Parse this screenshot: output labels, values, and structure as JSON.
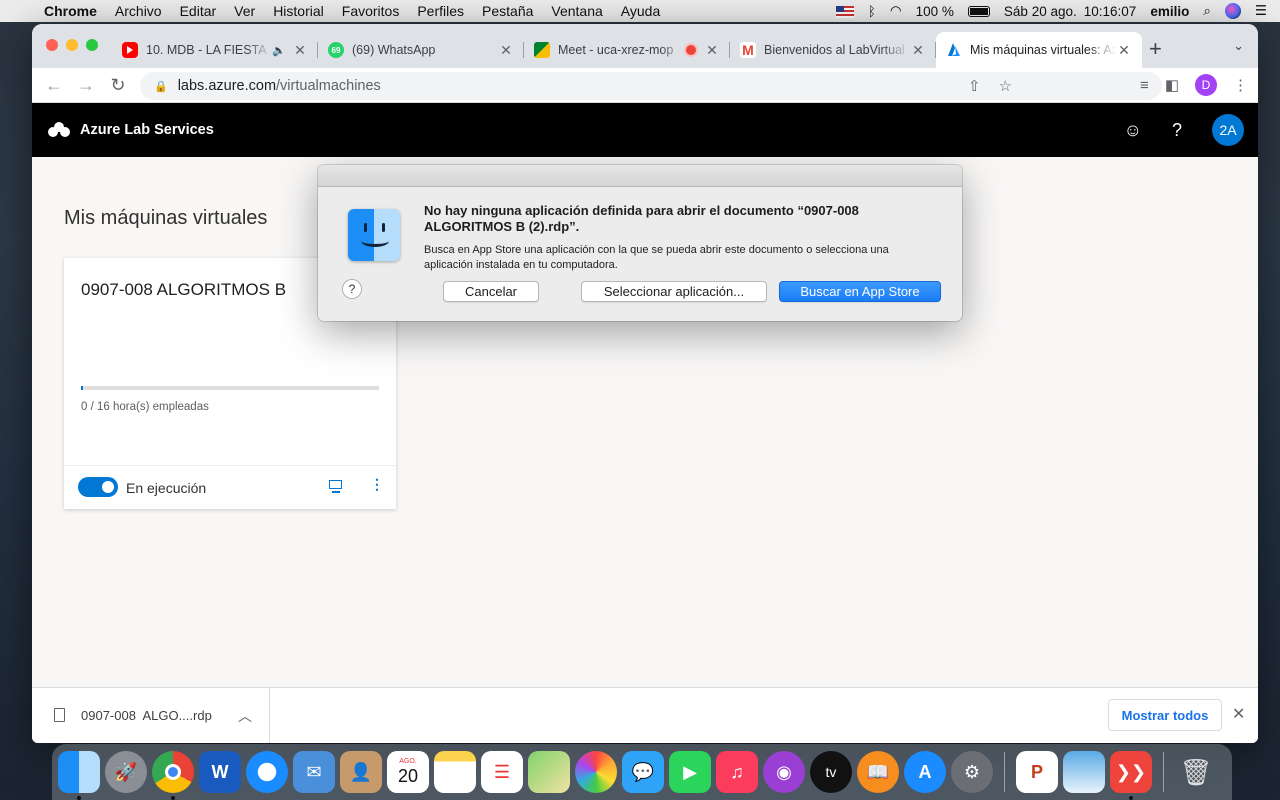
{
  "menubar": {
    "app": "Chrome",
    "items": [
      "Archivo",
      "Editar",
      "Ver",
      "Historial",
      "Favoritos",
      "Perfiles",
      "Pestaña",
      "Ventana",
      "Ayuda"
    ],
    "battery": "100 %",
    "date": "Sáb 20 ago.",
    "time": "10:16:07",
    "user": "emilio"
  },
  "tabs": [
    {
      "title": "10. MDB - LA FIESTA",
      "icon": "youtube-icon"
    },
    {
      "title": "(69) WhatsApp",
      "icon": "whatsapp-icon",
      "badge": "69"
    },
    {
      "title": "Meet - uca-xrez-mop",
      "icon": "meet-icon"
    },
    {
      "title": "Bienvenidos al LabVirtual",
      "icon": "gmail-icon"
    },
    {
      "title": "Mis máquinas virtuales: Azure",
      "icon": "azure-icon"
    }
  ],
  "address": {
    "host": "labs.azure.com",
    "path": "/virtualmachines"
  },
  "profile_initial": "D",
  "azure": {
    "brand": "Azure Lab Services",
    "avatar": "2A",
    "page_title": "Mis máquinas virtuales"
  },
  "vm": {
    "name": "0907-008 ALGORITMOS B",
    "hours": "0 / 16 hora(s) empleadas",
    "hours_fraction": 0.0,
    "state": "En ejecución",
    "more": "⋮"
  },
  "dialog": {
    "title": "No hay ninguna aplicación definida para abrir el documento “0907-008 ALGORITMOS B (2).rdp”.",
    "message": "Busca en App Store una aplicación con la que se pueda abrir este documento o selecciona una aplicación instalada en tu computadora.",
    "help": "?",
    "cancel": "Cancelar",
    "select": "Seleccionar aplicación...",
    "appstore": "Buscar en App Store"
  },
  "download": {
    "filename": "0907-008  ALGO....rdp",
    "show_all": "Mostrar todos"
  },
  "dock": {
    "calendar_month": "AGO.",
    "calendar_day": "20",
    "tv_label": "tv"
  },
  "colors": {
    "azure_blue": "#0078d4",
    "dialog_primary": "#1a7cf5",
    "header_bg": "#000000"
  }
}
